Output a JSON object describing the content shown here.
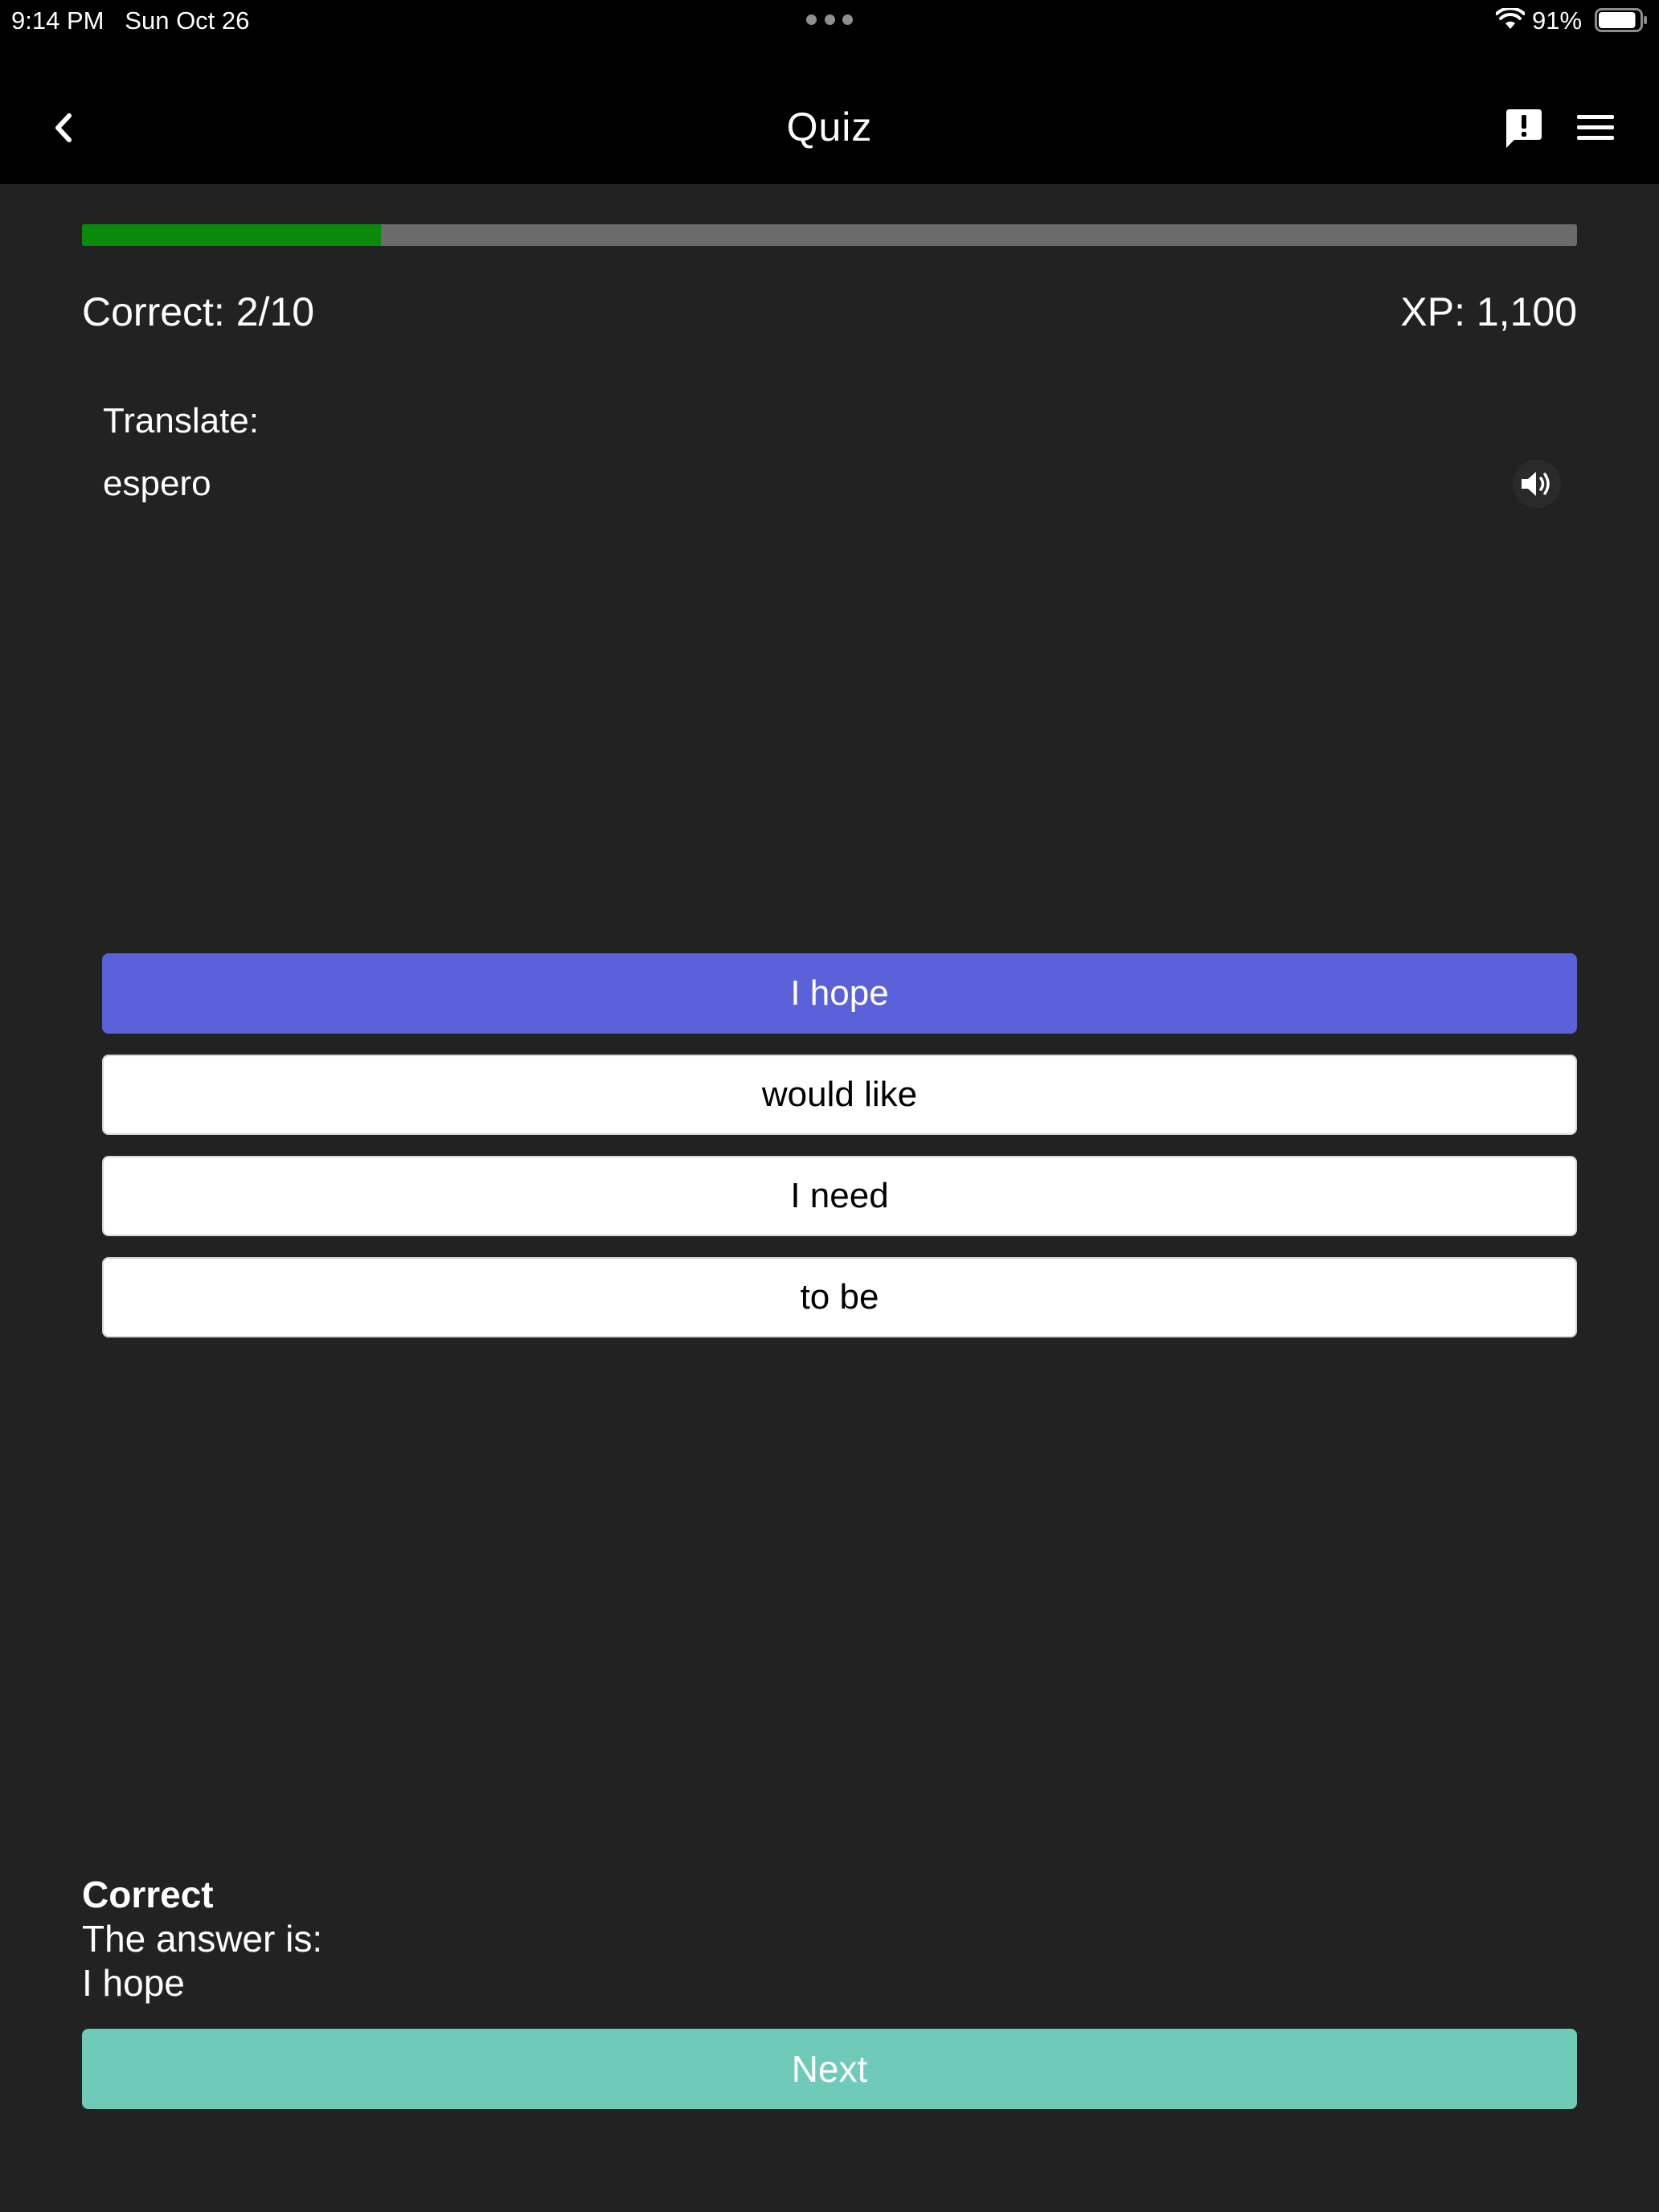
{
  "status_bar": {
    "time": "9:14 PM",
    "date": "Sun Oct 26",
    "battery": "91%",
    "battery_level": 0.91,
    "icons": [
      "wifi-icon",
      "battery-icon"
    ]
  },
  "nav": {
    "title": "Quiz",
    "icons": [
      "back-icon",
      "report-icon",
      "menu-icon"
    ]
  },
  "progress": {
    "fraction": 0.2
  },
  "score": {
    "correct": "Correct: 2/10",
    "xp": "XP: 1,100"
  },
  "prompt": {
    "label": "Translate:",
    "word": "espero",
    "icon": "speaker-icon"
  },
  "options": [
    {
      "label": "I hope",
      "selected": true
    },
    {
      "label": "would like",
      "selected": false
    },
    {
      "label": "I need",
      "selected": false
    },
    {
      "label": "to be",
      "selected": false
    }
  ],
  "feedback": {
    "title": "Correct",
    "line": "The answer is:",
    "answer": "I hope"
  },
  "next_label": "Next",
  "colors": {
    "background": "#222222",
    "header": "#000000",
    "progress_fill": "#0a8a0a",
    "progress_track": "#6b6b6b",
    "selected_option": "#5b61d9",
    "next_button": "#6fcab8"
  }
}
